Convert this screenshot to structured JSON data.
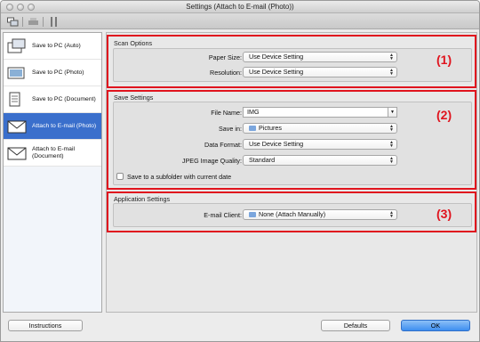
{
  "window": {
    "title": "Settings (Attach to E-mail (Photo))"
  },
  "toolbar": {
    "icons": [
      "scan-to-pc-icon",
      "printer-icon",
      "tools-icon"
    ]
  },
  "sidebar": {
    "items": [
      {
        "label": "Save to PC (Auto)",
        "icon": "save-to-pc-auto-icon",
        "selected": false
      },
      {
        "label": "Save to PC (Photo)",
        "icon": "save-to-pc-photo-icon",
        "selected": false
      },
      {
        "label": "Save to PC (Document)",
        "icon": "save-to-pc-document-icon",
        "selected": false
      },
      {
        "label": "Attach to E-mail (Photo)",
        "icon": "email-photo-icon",
        "selected": true
      },
      {
        "label_line1": "Attach to E-mail",
        "label_line2": "(Document)",
        "icon": "email-document-icon",
        "selected": false
      }
    ]
  },
  "scan_options": {
    "title": "Scan Options",
    "paper_size_label": "Paper Size:",
    "paper_size_value": "Use Device Setting",
    "resolution_label": "Resolution:",
    "resolution_value": "Use Device Setting",
    "annotation": "(1)"
  },
  "save_settings": {
    "title": "Save Settings",
    "file_name_label": "File Name:",
    "file_name_value": "IMG",
    "save_in_label": "Save in:",
    "save_in_value": "Pictures",
    "data_format_label": "Data Format:",
    "data_format_value": "Use Device Setting",
    "jpeg_quality_label": "JPEG Image Quality:",
    "jpeg_quality_value": "Standard",
    "subfolder_checkbox_label": "Save to a subfolder with current date",
    "subfolder_checked": false,
    "annotation": "(2)"
  },
  "application_settings": {
    "title": "Application Settings",
    "email_client_label": "E-mail Client:",
    "email_client_value": "None (Attach Manually)",
    "annotation": "(3)"
  },
  "buttons": {
    "instructions": "Instructions",
    "defaults": "Defaults",
    "ok": "OK"
  },
  "colors": {
    "annotation_red": "#e0141e",
    "selection_blue": "#3a6fcc"
  }
}
